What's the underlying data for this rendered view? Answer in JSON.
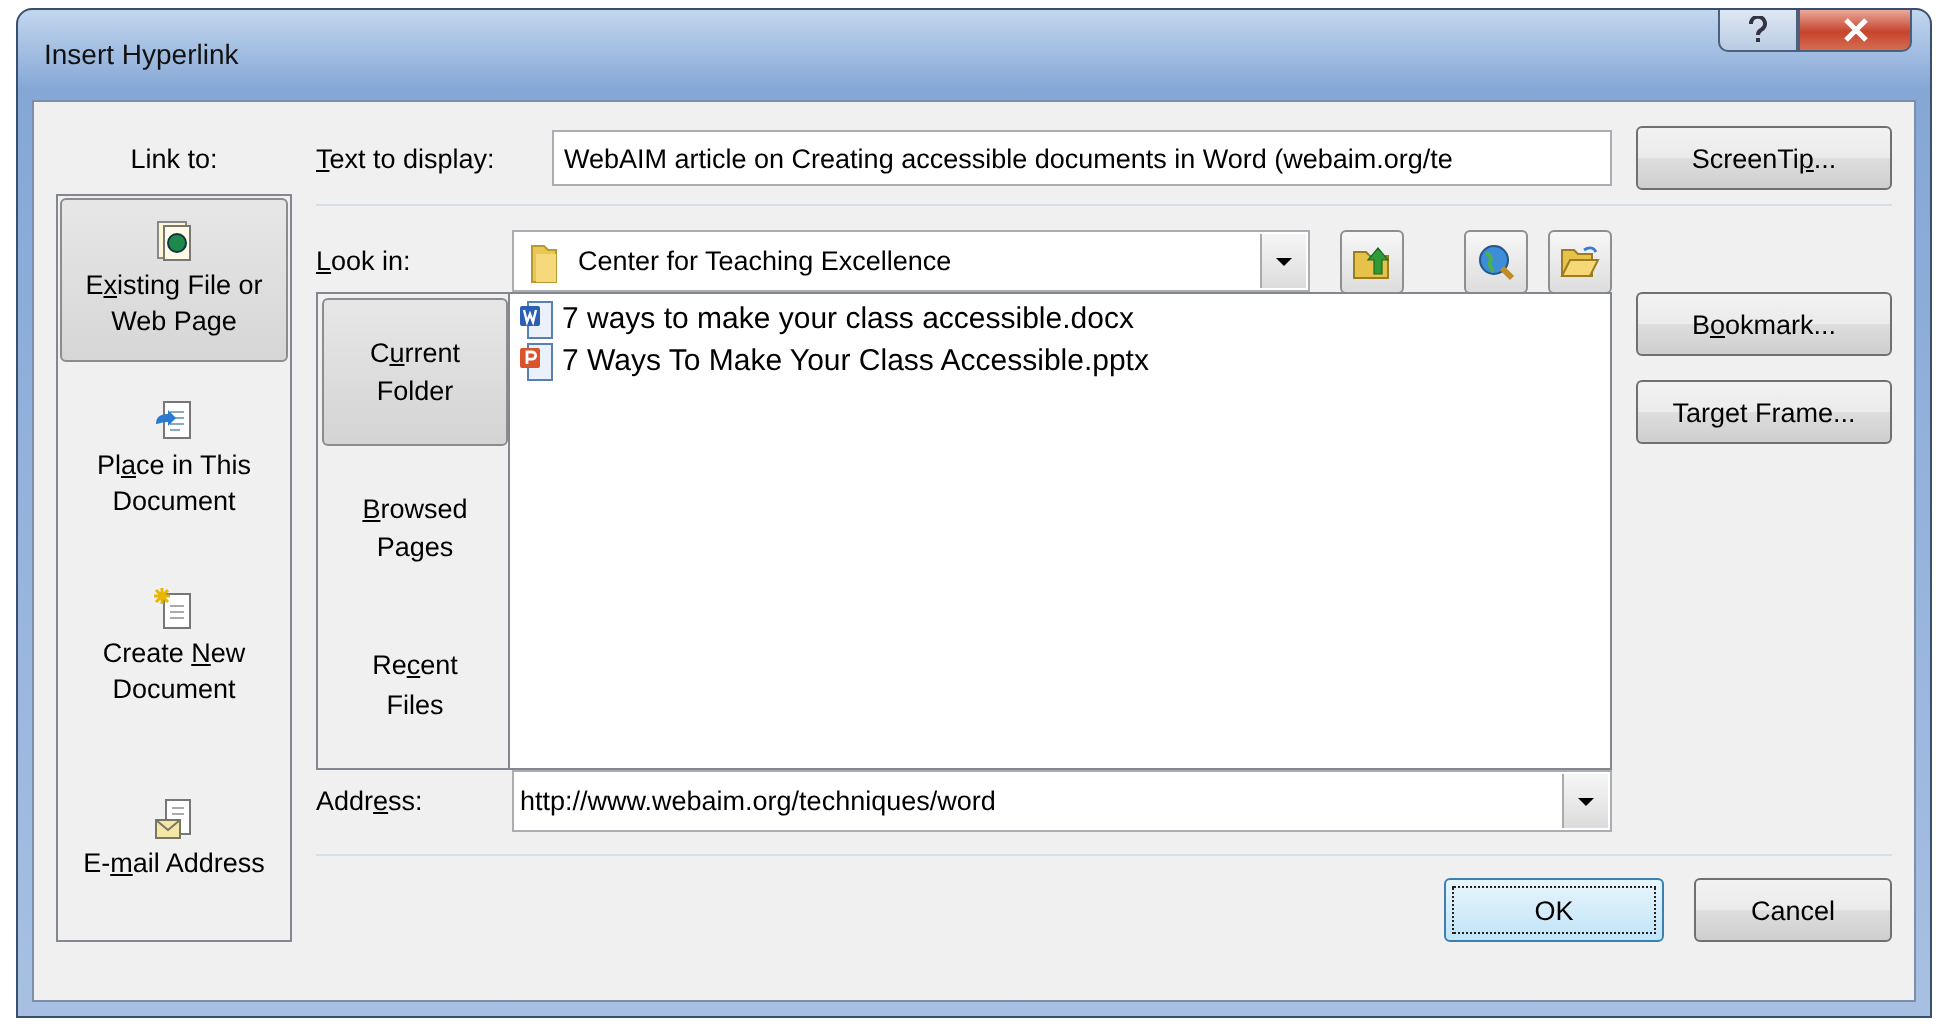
{
  "window": {
    "title": "Insert Hyperlink"
  },
  "link_to": {
    "label": "Link to:",
    "items": [
      {
        "label": {
          "before": "E",
          "key": "x",
          "after": "isting File or Web Page"
        },
        "kind": "file",
        "selected": true
      },
      {
        "label": {
          "before": "Pl",
          "key": "a",
          "after": "ce in This Document"
        },
        "kind": "place",
        "selected": false
      },
      {
        "label": {
          "before": "Create ",
          "key": "N",
          "after": "ew Document"
        },
        "kind": "new",
        "selected": false
      },
      {
        "label": {
          "before": "E-",
          "key": "m",
          "after": "ail Address"
        },
        "kind": "email",
        "selected": false
      }
    ]
  },
  "text_to_display": {
    "label": {
      "key": "T",
      "after": "ext to display:"
    },
    "value": "WebAIM article on Creating accessible documents in Word (webaim.org/te"
  },
  "look_in": {
    "label": {
      "key": "L",
      "after": "ook in:"
    },
    "value": "Center for Teaching Excellence"
  },
  "browse_tabs": [
    {
      "label": {
        "before": "C",
        "key": "u",
        "after": "rrent Folder"
      },
      "selected": true
    },
    {
      "label": {
        "key": "B",
        "after": "rowsed Pages"
      },
      "selected": false
    },
    {
      "label": {
        "before": "Re",
        "key": "c",
        "after": "ent Files"
      },
      "selected": false
    }
  ],
  "files": [
    {
      "name": "7 ways to make your class accessible.docx",
      "kind": "word"
    },
    {
      "name": "7 Ways To Make Your Class Accessible.pptx",
      "kind": "powerpoint"
    }
  ],
  "address": {
    "label": {
      "before": "Addr",
      "key": "e",
      "after": "ss:"
    },
    "value": "http://www.webaim.org/techniques/word"
  },
  "side_buttons": [
    {
      "label": {
        "before": "ScreenTi",
        "key": "p",
        "after": "..."
      }
    },
    {
      "label": {
        "before": "B",
        "key": "o",
        "after": "okmark..."
      }
    },
    {
      "label": {
        "before": "Tar",
        "key": "g",
        "after": "et Frame..."
      }
    }
  ],
  "footer_buttons": [
    {
      "label": "OK",
      "default": true
    },
    {
      "label": "Cancel",
      "default": false
    }
  ]
}
